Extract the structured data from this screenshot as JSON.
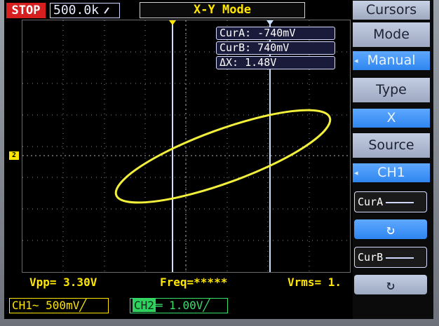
{
  "status": {
    "run_state": "STOP",
    "timebase": "500.0k"
  },
  "display": {
    "mode_title": "X-Y    Mode"
  },
  "cursors": {
    "cura": "CurA: -740mV",
    "curb": "CurB:  740mV",
    "delta": "ΔX:  1.48V"
  },
  "measurements": {
    "vpp": "Vpp= 3.30V",
    "freq": "Freq=*****",
    "vrms": "Vrms= 1."
  },
  "channels": {
    "ch1": "CH1~  500mV",
    "ch2_label": "CH2",
    "ch2_value": "1.00V"
  },
  "ground_marker": "2",
  "menu": {
    "header": "Cursors",
    "mode_title": "Mode",
    "mode_value": "Manual",
    "type_title": "Type",
    "type_value": "X",
    "source_title": "Source",
    "source_value": "CH1",
    "cura_label": "CurA",
    "curb_label": "CurB",
    "rotate_glyph": "↻"
  },
  "colors": {
    "trace": "#f2f03a",
    "cursor_line": "#cfe0ff",
    "stop": "#d81f1f",
    "menu_value": "#2f86f0"
  }
}
